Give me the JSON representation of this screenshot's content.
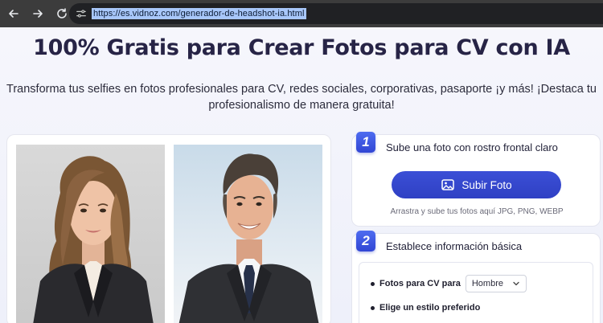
{
  "browser": {
    "url": "https://es.vidnoz.com/generador-de-headshot-ia.html",
    "back_icon": "arrow-left-icon",
    "forward_icon": "arrow-right-icon",
    "reload_icon": "reload-icon",
    "site_icon": "site-settings-icon"
  },
  "hero": {
    "title": "100% Gratis para Crear Fotos para CV con IA",
    "subtitle_line1": "Transforma tus selfies en fotos profesionales para CV, redes sociales, corporativas, pasaporte ¡y más! ¡Destaca tu",
    "subtitle_line2": "profesionalismo de manera gratuita!"
  },
  "samples": {
    "woman_icon": "sample-woman-portrait",
    "man_icon": "sample-man-portrait"
  },
  "step1": {
    "number": "1",
    "title": "Sube una foto con rostro frontal claro",
    "button_label": "Subir Foto",
    "button_icon": "image-upload-icon",
    "hint": "Arrastra y sube tus fotos aquí JPG, PNG, WEBP"
  },
  "step2": {
    "number": "2",
    "title": "Establece información básica",
    "gender_label": "Fotos para CV para",
    "gender_value": "Hombre",
    "style_label": "Elige un estilo preferido"
  },
  "colors": {
    "accent": "#3146d4",
    "title": "#272446"
  }
}
